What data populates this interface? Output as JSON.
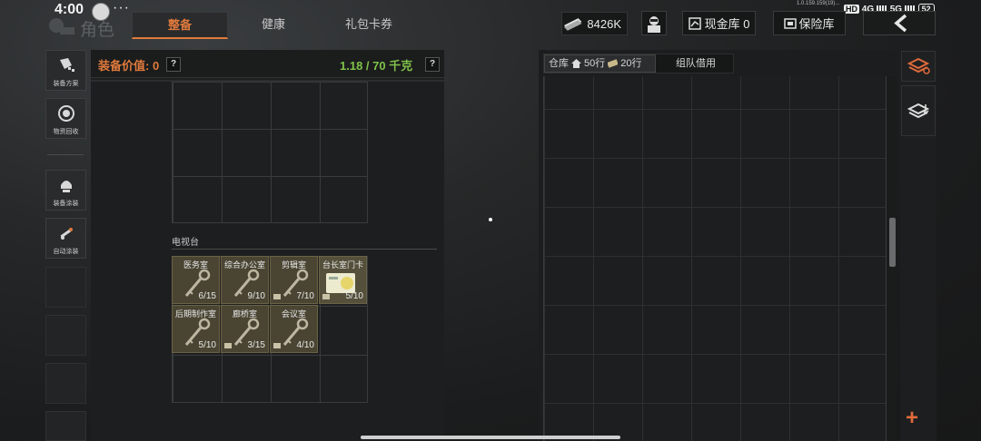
{
  "status_bar": {
    "time": "4:00",
    "dots": "···",
    "version": "1.0.159.159(19)...",
    "hd": "HD",
    "net1": "4G",
    "net2": "5G",
    "battery": "52"
  },
  "header": {
    "title": "角色",
    "tabs": [
      {
        "label": "整备",
        "active": true
      },
      {
        "label": "健康",
        "active": false
      },
      {
        "label": "礼包卡券",
        "active": false
      }
    ],
    "money": "8426K",
    "cash_vault": "现金库 0",
    "safe_box": "保险库"
  },
  "sidebar": {
    "items": [
      {
        "label": "装备方案",
        "icon": "loadout-icon"
      },
      {
        "label": "物资回收",
        "icon": "recycle-icon"
      },
      {
        "label": "装备涂装",
        "icon": "skin-icon"
      },
      {
        "label": "自动涂装",
        "icon": "auto-paint-icon"
      }
    ]
  },
  "left_panel": {
    "equip_value": "装备价值: 0",
    "help": "?",
    "weight": "1.18 / 70 千克",
    "section_title": "电视台",
    "items": [
      {
        "name": "医务室",
        "count": "6/15",
        "tagged": false,
        "type": "key"
      },
      {
        "name": "综合办公室",
        "count": "9/10",
        "tagged": false,
        "type": "key"
      },
      {
        "name": "剪辑室",
        "count": "7/10",
        "tagged": true,
        "type": "key"
      },
      {
        "name": "台长室门卡",
        "count": "5/10",
        "tagged": true,
        "type": "card"
      },
      {
        "name": "后期制作室",
        "count": "5/10",
        "tagged": false,
        "type": "key"
      },
      {
        "name": "廊桥室",
        "count": "3/15",
        "tagged": true,
        "type": "key"
      },
      {
        "name": "会议室",
        "count": "4/10",
        "tagged": true,
        "type": "key"
      }
    ]
  },
  "warehouse": {
    "tab_label": "仓库",
    "home_rows": "50行",
    "ticket_rows": "20行",
    "team_tab": "组队借用"
  },
  "colors": {
    "accent": "#e07a3d",
    "weight_green": "#7fc24a",
    "item_bg": "#4a4533"
  }
}
